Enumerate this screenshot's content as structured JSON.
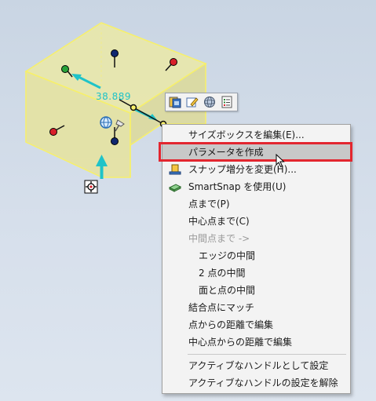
{
  "dimension": {
    "value": "38.889"
  },
  "menu": {
    "items": [
      {
        "label": "サイズボックスを編集(E)...",
        "icon": "none",
        "type": "item"
      },
      {
        "label": "パラメータを作成",
        "icon": "none",
        "type": "item",
        "highlighted": true
      },
      {
        "label": "スナップ増分を変更(H)...",
        "icon": "snap-increment-icon",
        "type": "item"
      },
      {
        "label": "SmartSnap を使用(U)",
        "icon": "smartsnap-icon",
        "type": "item"
      },
      {
        "label": "点まで(P)",
        "icon": "none",
        "type": "item"
      },
      {
        "label": "中心点まで(C)",
        "icon": "none",
        "type": "item"
      },
      {
        "label": "中間点まで ->",
        "icon": "none",
        "type": "item",
        "disabled": true
      },
      {
        "label": "エッジの中間",
        "icon": "none",
        "type": "subitem"
      },
      {
        "label": "2 点の中間",
        "icon": "none",
        "type": "subitem"
      },
      {
        "label": "面と点の中間",
        "icon": "none",
        "type": "subitem"
      },
      {
        "label": "結合点にマッチ",
        "icon": "none",
        "type": "item"
      },
      {
        "label": "点からの距離で編集",
        "icon": "none",
        "type": "item"
      },
      {
        "label": "中心点からの距離で編集",
        "icon": "none",
        "type": "item"
      },
      {
        "label": "アクティブなハンドルとして設定",
        "icon": "none",
        "type": "item"
      },
      {
        "label": "アクティブなハンドルの設定を解除",
        "icon": "none",
        "type": "item"
      }
    ]
  },
  "toolbar": {
    "icons": [
      "gallery-icon",
      "edit-icon",
      "sphere-icon",
      "list-icon"
    ]
  },
  "colors": {
    "box_face": "#ece9a4",
    "box_edge": "#f7f06a",
    "dimension": "#1fc3c8",
    "handle_red": "#d8202a",
    "handle_green": "#27a23a",
    "handle_navy": "#102870",
    "highlight_border": "#e3262f"
  }
}
